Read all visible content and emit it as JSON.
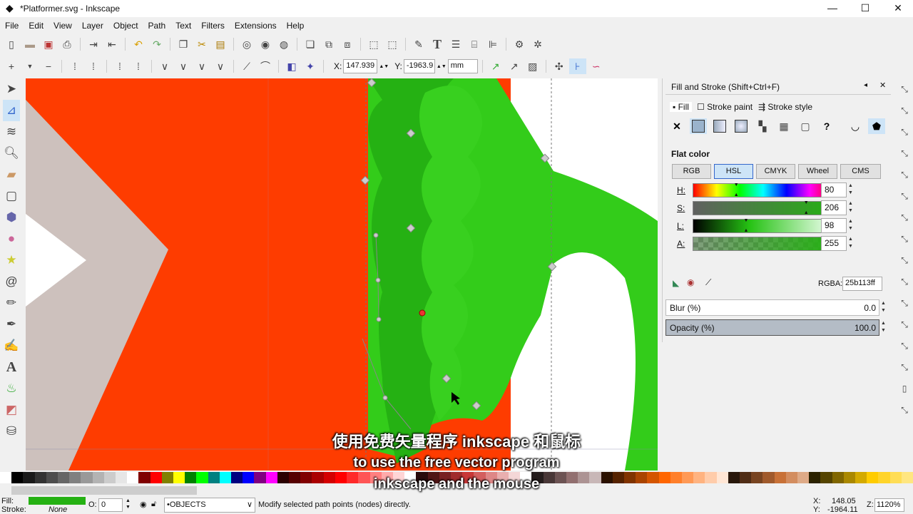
{
  "window": {
    "title": "*Platformer.svg - Inkscape",
    "minimize": "—",
    "maximize": "☐",
    "close": "✕"
  },
  "menu": [
    "File",
    "Edit",
    "View",
    "Layer",
    "Object",
    "Path",
    "Text",
    "Filters",
    "Extensions",
    "Help"
  ],
  "node_toolbar": {
    "x_label": "X:",
    "x_value": "147.939",
    "y_label": "Y:",
    "y_value": "-1963.9",
    "unit": "mm"
  },
  "panel": {
    "title": "Fill and Stroke (Shift+Ctrl+F)",
    "tabs": [
      "Fill",
      "Stroke paint",
      "Stroke style"
    ],
    "mode_label": "Flat color",
    "modes": [
      "RGB",
      "HSL",
      "CMYK",
      "Wheel",
      "CMS"
    ],
    "active_mode": "HSL",
    "sliders": [
      {
        "label": "H:",
        "value": "80",
        "fraction": 0.31
      },
      {
        "label": "S:",
        "value": "206",
        "fraction": 0.81
      },
      {
        "label": "L:",
        "value": "98",
        "fraction": 0.38
      },
      {
        "label": "A:",
        "value": "255",
        "fraction": 1.0
      }
    ],
    "rgba_label": "RGBA:",
    "rgba_value": "25b113ff",
    "blur_label": "Blur (%)",
    "blur_value": "0.0",
    "opacity_label": "Opacity (%)",
    "opacity_value": "100.0"
  },
  "status": {
    "fill_label": "Fill:",
    "stroke_label": "Stroke:",
    "stroke_value": "None",
    "fill_color": "#25b113",
    "o_label": "O:",
    "o_value": "0",
    "layer": "•OBJECTS",
    "message": "Modify selected path points (nodes) directly.",
    "cursor_x_label": "X:",
    "cursor_x": "148.05",
    "cursor_y_label": "Y:",
    "cursor_y": "-1964.11",
    "zoom_label": "Z:",
    "zoom": "1120%"
  },
  "subtitles": {
    "zh": "使用免费矢量程序 inkscape 和鼠标",
    "en1": "to use the free vector program",
    "en2": "inkscape and the mouse"
  },
  "colors": {
    "orange": "#fe3c00",
    "green": "#25b113",
    "light_green": "#33cc1a",
    "gray": "#cdc1bd"
  }
}
